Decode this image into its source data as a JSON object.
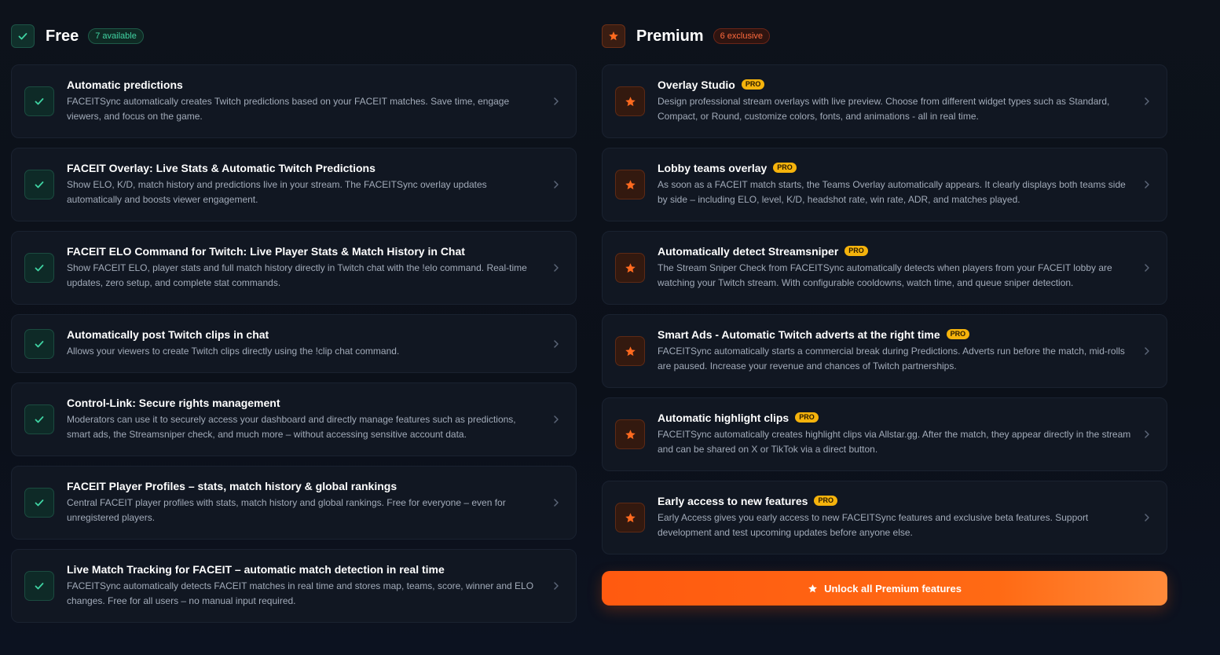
{
  "free": {
    "title": "Free",
    "badge": "7 available",
    "items": [
      {
        "title": "Automatic predictions",
        "desc": "FACEITSync automatically creates Twitch predictions based on your FACEIT matches. Save time, engage viewers, and focus on the game."
      },
      {
        "title": "FACEIT Overlay: Live Stats & Automatic Twitch Predictions",
        "desc": "Show ELO, K/D, match history and predictions live in your stream. The FACEITSync overlay updates automatically and boosts viewer engagement."
      },
      {
        "title": "FACEIT ELO Command for Twitch: Live Player Stats & Match History in Chat",
        "desc": "Show FACEIT ELO, player stats and full match history directly in Twitch chat with the !elo command. Real-time updates, zero setup, and complete stat commands."
      },
      {
        "title": "Automatically post Twitch clips in chat",
        "desc": "Allows your viewers to create Twitch clips directly using the !clip chat command."
      },
      {
        "title": "Control-Link: Secure rights management",
        "desc": "Moderators can use it to securely access your dashboard and directly manage features such as predictions, smart ads, the Streamsniper check, and much more – without accessing sensitive account data."
      },
      {
        "title": "FACEIT Player Profiles – stats, match history & global rankings",
        "desc": "Central FACEIT player profiles with stats, match history and global rankings. Free for everyone – even for unregistered players."
      },
      {
        "title": "Live Match Tracking for FACEIT – automatic match detection in real time",
        "desc": "FACEITSync automatically detects FACEIT matches in real time and stores map, teams, score, winner and ELO changes. Free for all users – no manual input required."
      }
    ]
  },
  "premium": {
    "title": "Premium",
    "badge": "6 exclusive",
    "pro_label": "PRO",
    "items": [
      {
        "title": "Overlay Studio",
        "desc": "Design professional stream overlays with live preview. Choose from different widget types such as Standard, Compact, or Round, customize colors, fonts, and animations - all in real time."
      },
      {
        "title": "Lobby teams overlay",
        "desc": "As soon as a FACEIT match starts, the Teams Overlay automatically appears. It clearly displays both teams side by side – including ELO, level, K/D, headshot rate, win rate, ADR, and matches played."
      },
      {
        "title": "Automatically detect Streamsniper",
        "desc": "The Stream Sniper Check from FACEITSync automatically detects when players from your FACEIT lobby are watching your Twitch stream. With configurable cooldowns, watch time, and queue sniper detection."
      },
      {
        "title": "Smart Ads - Automatic Twitch adverts at the right time",
        "desc": "FACEITSync automatically starts a commercial break during Predictions. Adverts run before the match, mid-rolls are paused. Increase your revenue and chances of Twitch partnerships."
      },
      {
        "title": "Automatic highlight clips",
        "desc": "FACEITSync automatically creates highlight clips via Allstar.gg. After the match, they appear directly in the stream and can be shared on X or TikTok via a direct button."
      },
      {
        "title": "Early access to new features",
        "desc": "Early Access gives you early access to new FACEITSync features and exclusive beta features. Support development and test upcoming updates before anyone else."
      }
    ],
    "unlock_label": "Unlock all Premium features"
  },
  "colors": {
    "free_accent": "#3fd3a2",
    "premium_accent": "#ff6a1f",
    "pro_badge": "#f5b30c"
  }
}
